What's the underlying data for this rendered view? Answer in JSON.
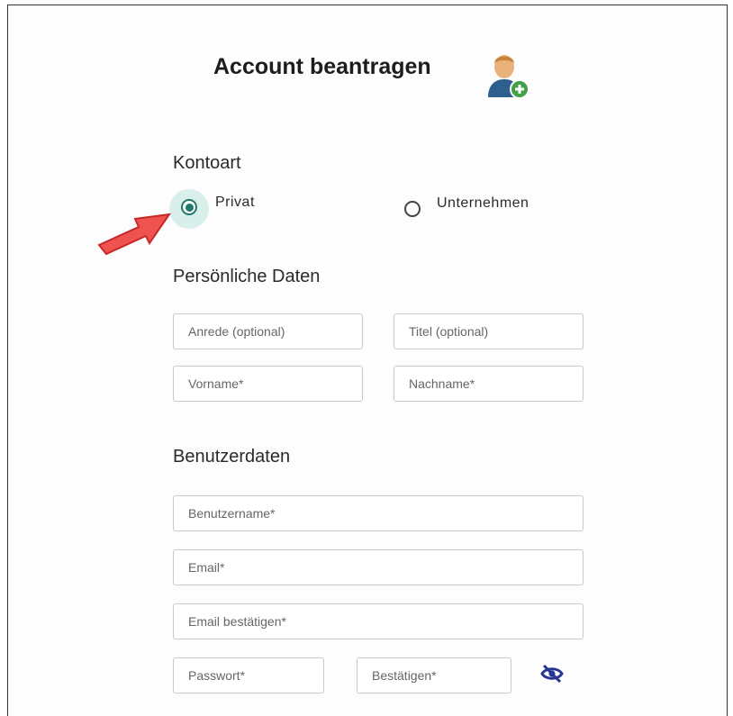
{
  "header": {
    "title": "Account beantragen",
    "icon": "add-user-icon"
  },
  "account_type": {
    "heading": "Kontoart",
    "options": [
      {
        "label": "Privat",
        "selected": true
      },
      {
        "label": "Unternehmen",
        "selected": false
      }
    ]
  },
  "personal": {
    "heading": "Persönliche Daten",
    "salutation_placeholder": "Anrede (optional)",
    "title_placeholder": "Titel (optional)",
    "firstname_placeholder": "Vorname*",
    "lastname_placeholder": "Nachname*"
  },
  "user": {
    "heading": "Benutzerdaten",
    "username_placeholder": "Benutzername*",
    "email_placeholder": "Email*",
    "email_confirm_placeholder": "Email bestätigen*",
    "password_placeholder": "Passwort*",
    "password_confirm_placeholder": "Bestätigen*",
    "visibility_icon": "eye-off-icon"
  },
  "colors": {
    "accent": "#1f7a6b",
    "arrow": "#e53935",
    "eye": "#283593"
  }
}
